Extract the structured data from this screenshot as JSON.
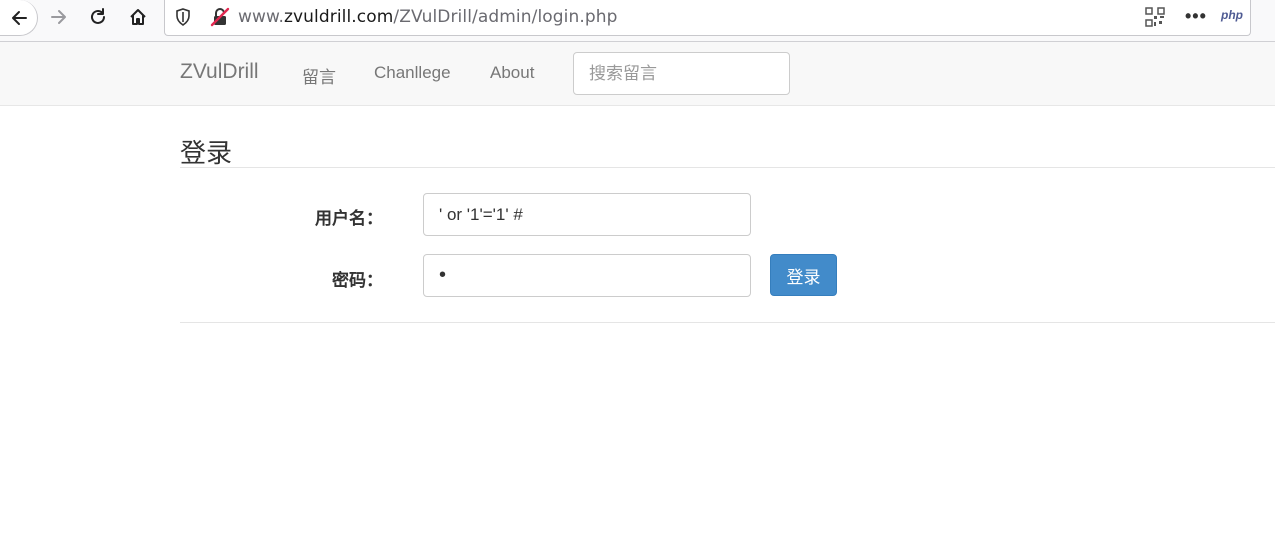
{
  "browser": {
    "url_prefix": "www.",
    "url_domain": "zvuldrill.com",
    "url_path": "/ZVulDrill/admin/login.php",
    "more_label": "•••",
    "php_label": "php"
  },
  "navbar": {
    "brand": "ZVulDrill",
    "links": [
      "留言",
      "Chanllege",
      "About"
    ],
    "search_placeholder": "搜索留言"
  },
  "form": {
    "title": "登录",
    "username_label": "用户名：",
    "username_value": "' or '1'='1' #",
    "password_label": "密码：",
    "password_value": "•",
    "submit_label": "登录"
  },
  "colors": {
    "primary_button": "#428bca",
    "navbar_bg": "#f8f8f8"
  }
}
